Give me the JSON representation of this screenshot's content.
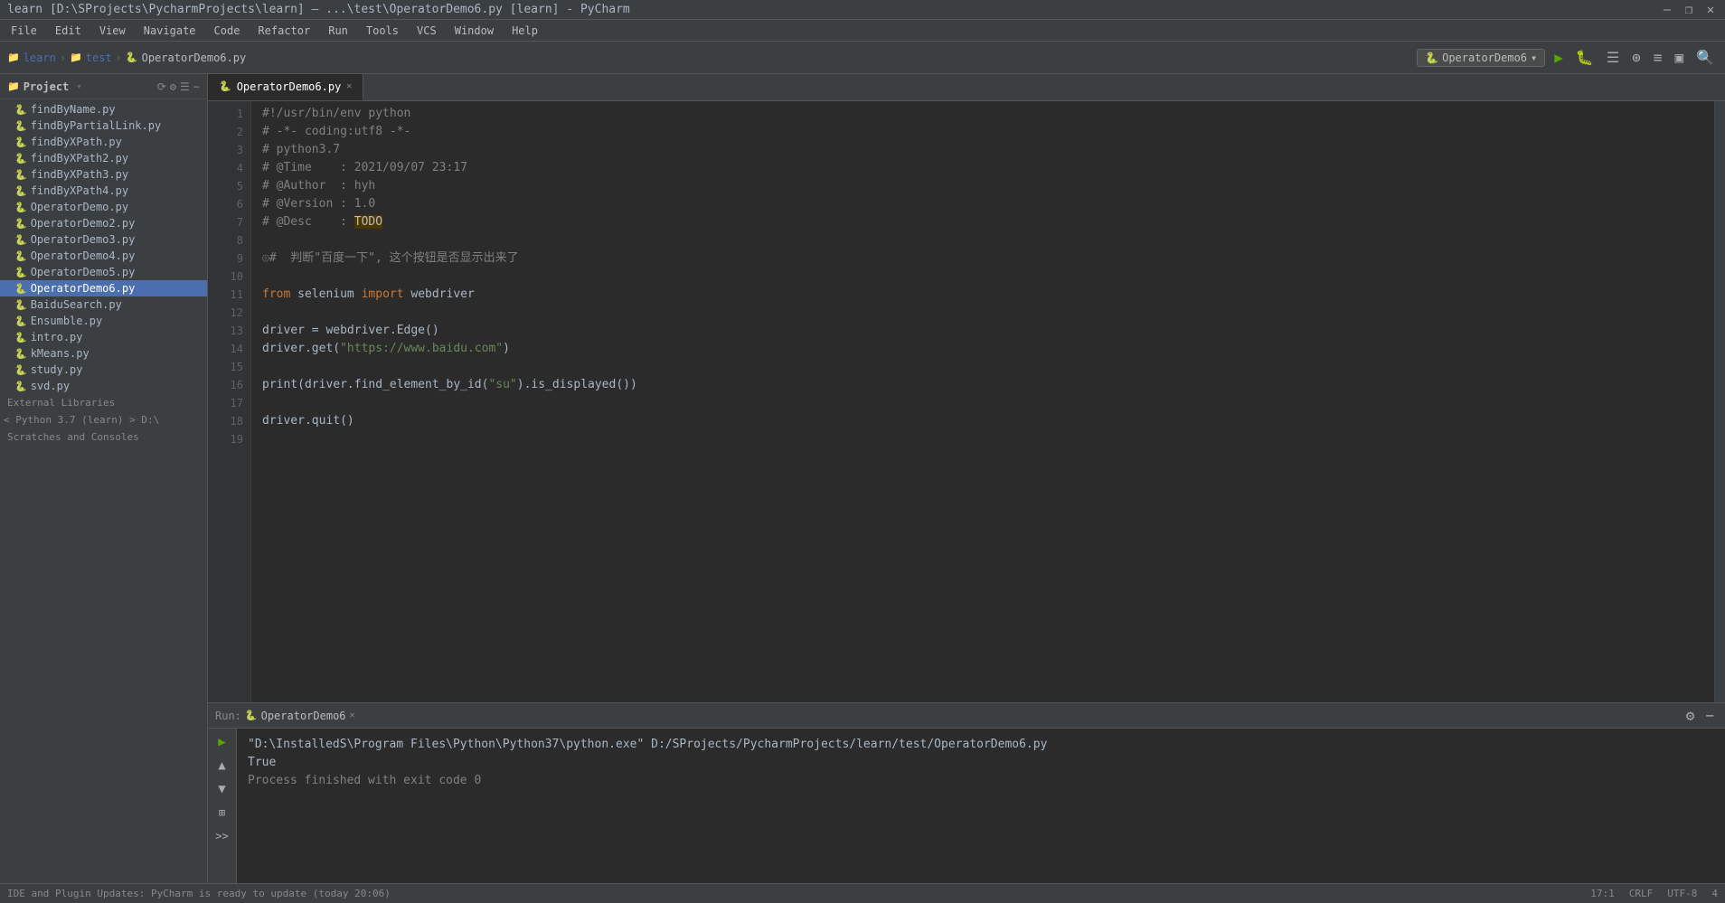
{
  "window": {
    "title": "learn [D:\\SProjects\\PycharmProjects\\learn] – ...\\test\\OperatorDemo6.py [learn] - PyCharm"
  },
  "title_controls": [
    "—",
    "❐",
    "✕"
  ],
  "menu": {
    "items": [
      "File",
      "Edit",
      "View",
      "Navigate",
      "Code",
      "Refactor",
      "Run",
      "Tools",
      "VCS",
      "Window",
      "Help"
    ]
  },
  "breadcrumb": {
    "items": [
      "learn",
      "test",
      "OperatorDemo6.py"
    ]
  },
  "run_config": {
    "label": "OperatorDemo6",
    "dropdown_icon": "▾"
  },
  "project": {
    "label": "Project",
    "files": [
      {
        "name": "findByName.py",
        "active": false
      },
      {
        "name": "findByPartialLink.py",
        "active": false
      },
      {
        "name": "findByXPath.py",
        "active": false
      },
      {
        "name": "findByXPath2.py",
        "active": false
      },
      {
        "name": "findByXPath3.py",
        "active": false
      },
      {
        "name": "findByXPath4.py",
        "active": false
      },
      {
        "name": "OperatorDemo.py",
        "active": false
      },
      {
        "name": "OperatorDemo2.py",
        "active": false
      },
      {
        "name": "OperatorDemo3.py",
        "active": false
      },
      {
        "name": "OperatorDemo4.py",
        "active": false
      },
      {
        "name": "OperatorDemo5.py",
        "active": false
      },
      {
        "name": "OperatorDemo6.py",
        "active": true
      },
      {
        "name": "BaiduSearch.py",
        "active": false
      },
      {
        "name": "Ensumble.py",
        "active": false
      },
      {
        "name": "intro.py",
        "active": false
      },
      {
        "name": "kMeans.py",
        "active": false
      },
      {
        "name": "study.py",
        "active": false
      },
      {
        "name": "svd.py",
        "active": false
      }
    ],
    "external_libraries": "External Libraries",
    "python_interpreter": "< Python 3.7 (learn) > D:\\",
    "scratches": "Scratches and Consoles"
  },
  "editor": {
    "tab": "OperatorDemo6.py",
    "lines": [
      {
        "num": 1,
        "content": "#!/usr/bin/env python",
        "type": "shebang"
      },
      {
        "num": 2,
        "content": "# -*- coding:utf8 -*-",
        "type": "comment"
      },
      {
        "num": 3,
        "content": "# python3.7",
        "type": "comment"
      },
      {
        "num": 4,
        "content": "# @Time    : 2021/09/07 23:17",
        "type": "comment"
      },
      {
        "num": 5,
        "content": "# @Author  : hyh",
        "type": "comment"
      },
      {
        "num": 6,
        "content": "# @Version : 1.0",
        "type": "comment"
      },
      {
        "num": 7,
        "content": "# @Desc    : TODO",
        "type": "comment_todo"
      },
      {
        "num": 8,
        "content": "",
        "type": "blank"
      },
      {
        "num": 9,
        "content": "#  判断\"百度一下\", 这个按钮是否显示出来了",
        "type": "comment"
      },
      {
        "num": 10,
        "content": "",
        "type": "blank"
      },
      {
        "num": 11,
        "content": "from selenium import webdriver",
        "type": "import"
      },
      {
        "num": 12,
        "content": "",
        "type": "blank"
      },
      {
        "num": 13,
        "content": "driver = webdriver.Edge()",
        "type": "code"
      },
      {
        "num": 14,
        "content": "driver.get(\"https://www.baidu.com\")",
        "type": "code"
      },
      {
        "num": 15,
        "content": "",
        "type": "blank"
      },
      {
        "num": 16,
        "content": "print(driver.find_element_by_id(\"su\").is_displayed())",
        "type": "code"
      },
      {
        "num": 17,
        "content": "",
        "type": "blank"
      },
      {
        "num": 18,
        "content": "driver.quit()",
        "type": "code"
      },
      {
        "num": 19,
        "content": "",
        "type": "blank"
      }
    ]
  },
  "run_panel": {
    "label": "Run:",
    "tab": "OperatorDemo6",
    "output": [
      "\"D:\\InstalledS\\Program Files\\Python\\Python37\\python.exe\" D:/SProjects/PycharmProjects/learn/test/OperatorDemo6.py",
      "True",
      "",
      "Process finished with exit code 0"
    ]
  },
  "status_bar": {
    "notification": "IDE and Plugin Updates: PyCharm is ready to update  (today 20:06)",
    "position": "17:1",
    "crlf": "CRLF",
    "encoding": "UTF-8",
    "indent": "4"
  }
}
